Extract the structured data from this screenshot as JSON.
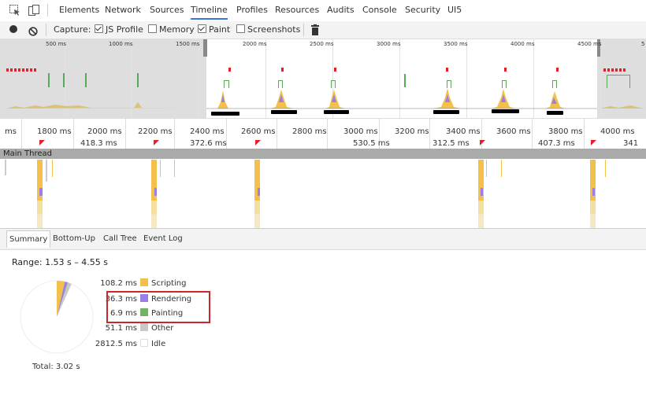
{
  "tabs": [
    {
      "label": "Elements"
    },
    {
      "label": "Network"
    },
    {
      "label": "Sources"
    },
    {
      "label": "Timeline",
      "active": true
    },
    {
      "label": "Profiles"
    },
    {
      "label": "Resources"
    },
    {
      "label": "Audits"
    },
    {
      "label": "Console"
    },
    {
      "label": "Security"
    },
    {
      "label": "UI5"
    }
  ],
  "toolbar": {
    "capture_label": "Capture:",
    "js_profile": {
      "label": "JS Profile",
      "checked": true
    },
    "memory": {
      "label": "Memory",
      "checked": false
    },
    "paint": {
      "label": "Paint",
      "checked": true
    },
    "screenshots": {
      "label": "Screenshots",
      "checked": false
    }
  },
  "overview": {
    "labels": [
      "500 ms",
      "1000 ms",
      "1500 ms",
      "2000 ms",
      "2500 ms",
      "3000 ms",
      "3500 ms",
      "4000 ms",
      "4500 ms",
      "5"
    ]
  },
  "ruler": {
    "labels": [
      "ms",
      "1800 ms",
      "2000 ms",
      "2200 ms",
      "2400 ms",
      "2600 ms",
      "2800 ms",
      "3000 ms",
      "3200 ms",
      "3400 ms",
      "3600 ms",
      "3800 ms",
      "4000 ms"
    ],
    "frame_durations": [
      "418.3 ms",
      "372.6 ms",
      "530.5 ms",
      "312.5 ms",
      "407.3 ms",
      "341"
    ]
  },
  "main_thread_label": "Main Thread",
  "bottom_tabs": [
    {
      "label": "Summary",
      "selected": true
    },
    {
      "label": "Bottom-Up"
    },
    {
      "label": "Call Tree"
    },
    {
      "label": "Event Log"
    }
  ],
  "summary": {
    "range": "Range: 1.53 s – 4.55 s",
    "rows": [
      {
        "value": "108.2 ms",
        "label": "Scripting",
        "color": "#f2c04b",
        "ms": 108.2
      },
      {
        "value": "36.3 ms",
        "label": "Rendering",
        "color": "#9b7fe6",
        "ms": 36.3
      },
      {
        "value": "6.9 ms",
        "label": "Painting",
        "color": "#71b363",
        "ms": 6.9
      },
      {
        "value": "51.1 ms",
        "label": "Other",
        "color": "#c8c8c8",
        "ms": 51.1
      },
      {
        "value": "2812.5 ms",
        "label": "Idle",
        "color": "#ffffff",
        "ms": 2812.5
      }
    ],
    "total": "Total: 3.02 s"
  },
  "colors": {
    "accent": "#3879d9",
    "highlight_box": "#c8282a",
    "flag": "#e0202a"
  }
}
